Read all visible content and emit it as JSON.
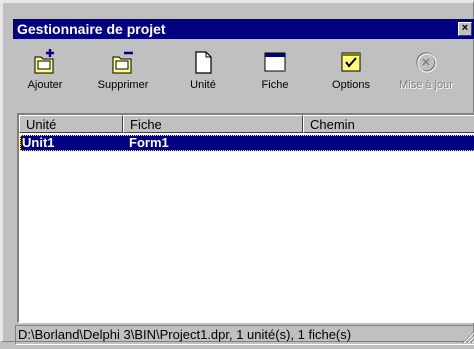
{
  "window": {
    "title": "Gestionnaire de projet",
    "close_label": "×"
  },
  "toolbar": {
    "buttons": [
      {
        "label": "Ajouter",
        "icon": "add-unit-icon",
        "enabled": true
      },
      {
        "label": "Supprimer",
        "icon": "remove-unit-icon",
        "enabled": true
      },
      {
        "label": "Unité",
        "icon": "unit-icon",
        "enabled": true
      },
      {
        "label": "Fiche",
        "icon": "form-icon",
        "enabled": true
      },
      {
        "label": "Options",
        "icon": "options-icon",
        "enabled": true
      },
      {
        "label": "Mise à jour",
        "icon": "update-icon",
        "enabled": false
      }
    ]
  },
  "list": {
    "columns": [
      "Unité",
      "Fiche",
      "Chemin"
    ],
    "rows": [
      {
        "unit": "Unit1",
        "form": "Form1",
        "path": "",
        "selected": true
      }
    ]
  },
  "statusbar": {
    "text": "D:\\Borland\\Delphi 3\\BIN\\Project1.dpr, 1 unité(s), 1 fiche(s)"
  },
  "colors": {
    "titlebar": "#000080",
    "face": "#c0c0c0",
    "selection": "#000080"
  }
}
